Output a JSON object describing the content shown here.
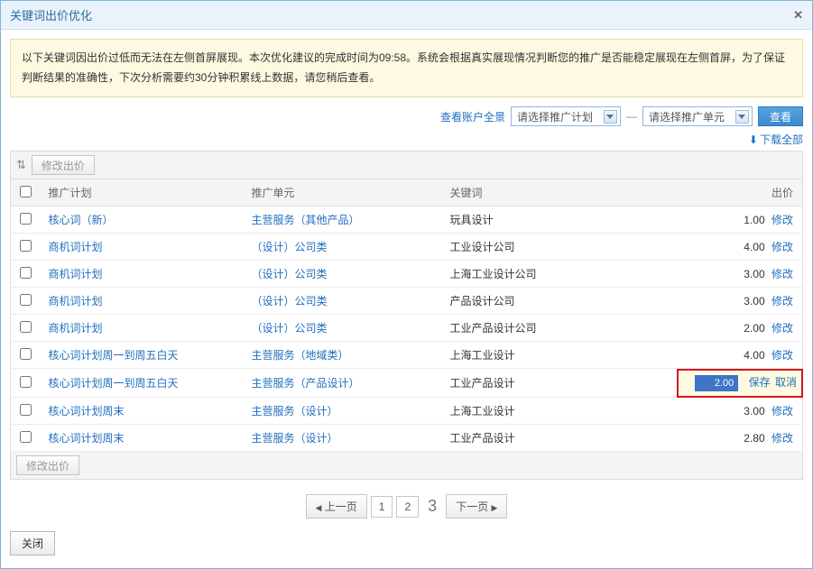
{
  "dialog": {
    "title": "关键词出价优化"
  },
  "warning": "以下关键词因出价过低而无法在左侧首屏展现。本次优化建议的完成时间为09:58。系统会根据真实展现情况判断您的推广是否能稳定展现在左侧首屏，为了保证判断结果的准确性，下次分析需要约30分钟积累线上数据，请您稍后查看。",
  "filter": {
    "account_panorama": "查看账户全景",
    "plan_placeholder": "请选择推广计划",
    "unit_placeholder": "请选择推广单元",
    "view_btn": "查看",
    "download_all": "下载全部"
  },
  "toolbar": {
    "modify_bid": "修改出价"
  },
  "columns": {
    "plan": "推广计划",
    "unit": "推广单元",
    "keyword": "关键词",
    "bid": "出价"
  },
  "actions": {
    "modify": "修改",
    "save": "保存",
    "cancel": "取消"
  },
  "rows": [
    {
      "plan": "核心词（新）",
      "unit": "主营服务（其他产品）",
      "keyword": "玩具设计",
      "bid": "1.00",
      "editing": false
    },
    {
      "plan": "商机词计划",
      "unit": "（设计）公司类",
      "keyword": "工业设计公司",
      "bid": "4.00",
      "editing": false
    },
    {
      "plan": "商机词计划",
      "unit": "（设计）公司类",
      "keyword": "上海工业设计公司",
      "bid": "3.00",
      "editing": false
    },
    {
      "plan": "商机词计划",
      "unit": "（设计）公司类",
      "keyword": "产品设计公司",
      "bid": "3.00",
      "editing": false
    },
    {
      "plan": "商机词计划",
      "unit": "（设计）公司类",
      "keyword": "工业产品设计公司",
      "bid": "2.00",
      "editing": false
    },
    {
      "plan": "核心词计划周一到周五白天",
      "unit": "主营服务（地域类）",
      "keyword": "上海工业设计",
      "bid": "4.00",
      "editing": false
    },
    {
      "plan": "核心词计划周一到周五白天",
      "unit": "主营服务（产品设计）",
      "keyword": "工业产品设计",
      "bid": "2.00",
      "editing": true
    },
    {
      "plan": "核心词计划周末",
      "unit": "主营服务（设计）",
      "keyword": "上海工业设计",
      "bid": "3.00",
      "editing": false
    },
    {
      "plan": "核心词计划周末",
      "unit": "主营服务（设计）",
      "keyword": "工业产品设计",
      "bid": "2.80",
      "editing": false
    }
  ],
  "pager": {
    "prev": "上一页",
    "p1": "1",
    "p2": "2",
    "current": "3",
    "next": "下一页"
  },
  "close_btn": "关闭"
}
